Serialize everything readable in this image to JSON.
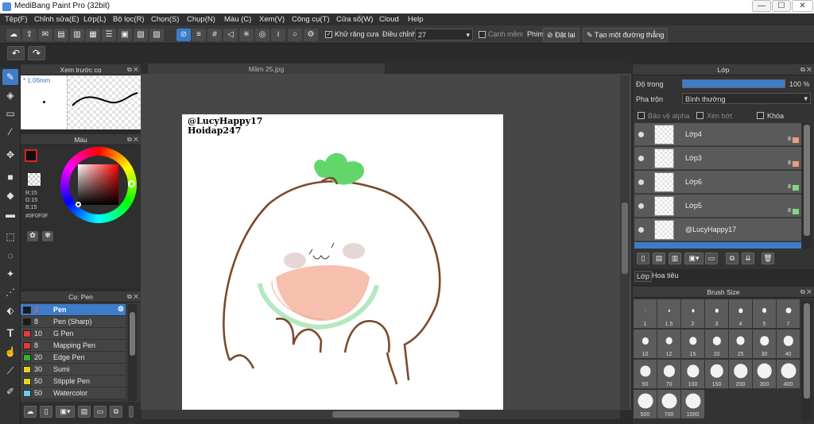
{
  "window": {
    "title": "MediBang Paint Pro (32bit)",
    "min": "—",
    "max": "☐",
    "close": "✕"
  },
  "menu": [
    "Tệp(F)",
    "Chỉnh sửa(E)",
    "Lớp(L)",
    "Bộ lọc(R)",
    "Chọn(S)",
    "Chụp(N)",
    "Màu (C)",
    "Xem(V)",
    "Công cụ(T)",
    "Cửa sổ(W)",
    "Cloud",
    "Help"
  ],
  "toolbar": {
    "antialias_label": "Khử răng cưa",
    "correction_label": "Điều chỉnh",
    "correction_value": "27",
    "edge_label": "Cạnh mềm",
    "key_label": "Phím",
    "reset_label": "Đặt lại",
    "straight_line_label": "Tạo một đường thẳng"
  },
  "undo": {
    "undo_icon": "↶",
    "redo_icon": "↷"
  },
  "preview": {
    "title": "Xem trước cọ",
    "size": "* 1.06mm"
  },
  "color": {
    "title": "Màu",
    "r": "R:15",
    "g": "G:15",
    "b": "B:15",
    "hex": "#0F0F0F",
    "fg": "#0f0f0f"
  },
  "pens": {
    "title": "Cọ: Pen",
    "items": [
      {
        "color": "#1a1a1a",
        "size": "3",
        "name": "Pen",
        "selected": true
      },
      {
        "color": "#1a1a1a",
        "size": "8",
        "name": "Pen (Sharp)"
      },
      {
        "color": "#e33b3b",
        "size": "10",
        "name": "G Pen"
      },
      {
        "color": "#e33b3b",
        "size": "8",
        "name": "Mapping Pen"
      },
      {
        "color": "#2db52d",
        "size": "20",
        "name": "Edge Pen"
      },
      {
        "color": "#e8d21e",
        "size": "30",
        "name": "Sumi"
      },
      {
        "color": "#e8d21e",
        "size": "50",
        "name": "Stipple Pen"
      },
      {
        "color": "#6cc8f2",
        "size": "50",
        "name": "Watercolor"
      }
    ]
  },
  "document": {
    "tab": "Mầm 25.jpg",
    "watermark1": "@LucyHappy17",
    "watermark2": "Hoidap247"
  },
  "layers": {
    "title": "Lớp",
    "opacity_label": "Độ trong",
    "opacity_value": "100 %",
    "blend_label": "Pha trộn",
    "blend_value": "Bình thường",
    "protect_alpha": "Bảo vệ alpha",
    "clipping": "Xén bớt",
    "lock": "Khóa",
    "items": [
      {
        "name": "Lớp4",
        "num": "8",
        "swatch": "#f29a7a"
      },
      {
        "name": "Lớp3",
        "num": "8",
        "swatch": "#f29a7a"
      },
      {
        "name": "Lớp6",
        "num": "8",
        "swatch": "#7fd87f"
      },
      {
        "name": "Lớp5",
        "num": "8",
        "swatch": "#7fd87f"
      },
      {
        "name": "@LucyHappy17",
        "num": "",
        "swatch": ""
      }
    ],
    "tab_layer": "Lớp",
    "tab_nav": "Hoa tiêu"
  },
  "brush_size": {
    "title": "Brush Size",
    "sizes": [
      "1",
      "1.5",
      "2",
      "3",
      "4",
      "5",
      "7",
      "10",
      "12",
      "15",
      "20",
      "25",
      "30",
      "40",
      "50",
      "70",
      "100",
      "150",
      "200",
      "300",
      "400",
      "500",
      "700",
      "1000"
    ]
  }
}
